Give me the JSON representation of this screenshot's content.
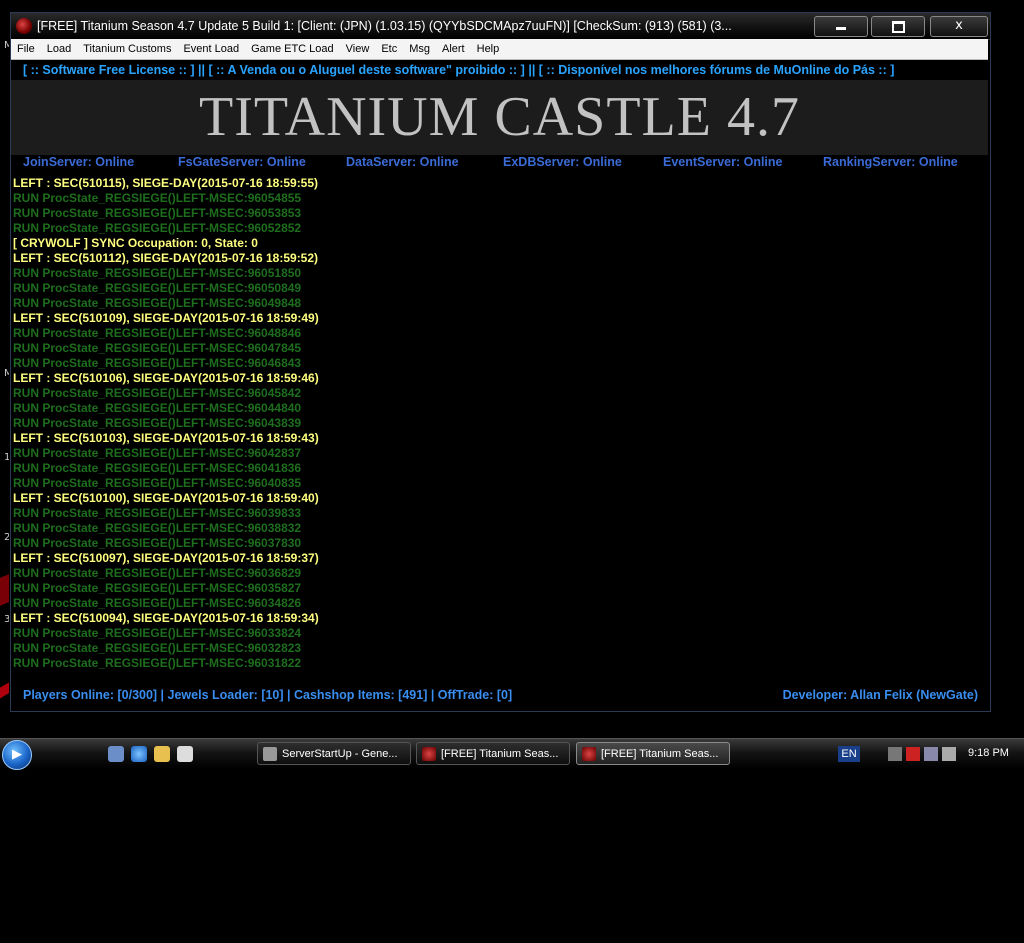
{
  "window": {
    "title": "[FREE] Titanium Season 4.7 Update 5 Build 1: [Client: (JPN) (1.03.15) (QYYbSDCMApz7uuFN)] [CheckSum: (913) (581) (3...",
    "buttons": {
      "minimize": "minimize",
      "maximize": "maximize",
      "close": "x"
    }
  },
  "menu": [
    "File",
    "Load",
    "Titanium Customs",
    "Event Load",
    "Game ETC Load",
    "View",
    "Etc",
    "Msg",
    "Alert",
    "Help"
  ],
  "notice": "[ :: Software Free License :: ] || [ :: A Venda ou o Aluguel deste software\" proibido :: ] || [ :: Disponível nos melhores fórums de MuOnline do Pás :: ]",
  "banner": {
    "title": "TITANIUM CASTLE 4.7"
  },
  "servers": [
    {
      "label": "JoinServer: Online"
    },
    {
      "label": "FsGateServer: Online"
    },
    {
      "label": "DataServer: Online"
    },
    {
      "label": "ExDBServer: Online"
    },
    {
      "label": "EventServer: Online"
    },
    {
      "label": "RankingServer: Online"
    }
  ],
  "log": [
    {
      "text": "LEFT : SEC(510115), SIEGE-DAY(2015-07-16 18:59:55)",
      "color": "yellow"
    },
    {
      "text": "RUN ProcState_REGSIEGE()LEFT-MSEC:96054855",
      "color": "green"
    },
    {
      "text": "RUN ProcState_REGSIEGE()LEFT-MSEC:96053853",
      "color": "green"
    },
    {
      "text": "RUN ProcState_REGSIEGE()LEFT-MSEC:96052852",
      "color": "green"
    },
    {
      "text": "[ CRYWOLF ] SYNC Occupation: 0, State: 0",
      "color": "yellow"
    },
    {
      "text": "LEFT : SEC(510112), SIEGE-DAY(2015-07-16 18:59:52)",
      "color": "yellow"
    },
    {
      "text": "RUN ProcState_REGSIEGE()LEFT-MSEC:96051850",
      "color": "green"
    },
    {
      "text": "RUN ProcState_REGSIEGE()LEFT-MSEC:96050849",
      "color": "green"
    },
    {
      "text": "RUN ProcState_REGSIEGE()LEFT-MSEC:96049848",
      "color": "green"
    },
    {
      "text": "LEFT : SEC(510109), SIEGE-DAY(2015-07-16 18:59:49)",
      "color": "yellow"
    },
    {
      "text": "RUN ProcState_REGSIEGE()LEFT-MSEC:96048846",
      "color": "green"
    },
    {
      "text": "RUN ProcState_REGSIEGE()LEFT-MSEC:96047845",
      "color": "green"
    },
    {
      "text": "RUN ProcState_REGSIEGE()LEFT-MSEC:96046843",
      "color": "green"
    },
    {
      "text": "LEFT : SEC(510106), SIEGE-DAY(2015-07-16 18:59:46)",
      "color": "yellow"
    },
    {
      "text": "RUN ProcState_REGSIEGE()LEFT-MSEC:96045842",
      "color": "green"
    },
    {
      "text": "RUN ProcState_REGSIEGE()LEFT-MSEC:96044840",
      "color": "green"
    },
    {
      "text": "RUN ProcState_REGSIEGE()LEFT-MSEC:96043839",
      "color": "green"
    },
    {
      "text": "LEFT : SEC(510103), SIEGE-DAY(2015-07-16 18:59:43)",
      "color": "yellow"
    },
    {
      "text": "RUN ProcState_REGSIEGE()LEFT-MSEC:96042837",
      "color": "green"
    },
    {
      "text": "RUN ProcState_REGSIEGE()LEFT-MSEC:96041836",
      "color": "green"
    },
    {
      "text": "RUN ProcState_REGSIEGE()LEFT-MSEC:96040835",
      "color": "green"
    },
    {
      "text": "LEFT : SEC(510100), SIEGE-DAY(2015-07-16 18:59:40)",
      "color": "yellow"
    },
    {
      "text": "RUN ProcState_REGSIEGE()LEFT-MSEC:96039833",
      "color": "green"
    },
    {
      "text": "RUN ProcState_REGSIEGE()LEFT-MSEC:96038832",
      "color": "green"
    },
    {
      "text": "RUN ProcState_REGSIEGE()LEFT-MSEC:96037830",
      "color": "green"
    },
    {
      "text": "LEFT : SEC(510097), SIEGE-DAY(2015-07-16 18:59:37)",
      "color": "yellow"
    },
    {
      "text": "RUN ProcState_REGSIEGE()LEFT-MSEC:96036829",
      "color": "green"
    },
    {
      "text": "RUN ProcState_REGSIEGE()LEFT-MSEC:96035827",
      "color": "green"
    },
    {
      "text": "RUN ProcState_REGSIEGE()LEFT-MSEC:96034826",
      "color": "green"
    },
    {
      "text": "LEFT : SEC(510094), SIEGE-DAY(2015-07-16 18:59:34)",
      "color": "yellow"
    },
    {
      "text": "RUN ProcState_REGSIEGE()LEFT-MSEC:96033824",
      "color": "green"
    },
    {
      "text": "RUN ProcState_REGSIEGE()LEFT-MSEC:96032823",
      "color": "green"
    },
    {
      "text": "RUN ProcState_REGSIEGE()LEFT-MSEC:96031822",
      "color": "green"
    }
  ],
  "footer": {
    "left": "Players Online: [0/300] | Jewels Loader: [10] | Cashshop Items: [491] | OffTrade: [0]",
    "right": "Developer: Allan Felix (NewGate)"
  },
  "taskbar": {
    "items": [
      {
        "label": "ServerStartUp - Gene..."
      },
      {
        "label": "[FREE] Titanium Seas..."
      },
      {
        "label": "[FREE] Titanium Seas..."
      }
    ],
    "language": "EN",
    "clock": "9:18 PM"
  },
  "colors": {
    "log_yellow": "#ffff80",
    "log_green": "#1e6e1e",
    "server_blue": "#3b6bd6",
    "notice_blue": "#2aa4ff",
    "wallpaper_red": "#8a000a"
  },
  "desktop_glyphs": [
    "M",
    "M",
    "1",
    "2",
    "3"
  ]
}
